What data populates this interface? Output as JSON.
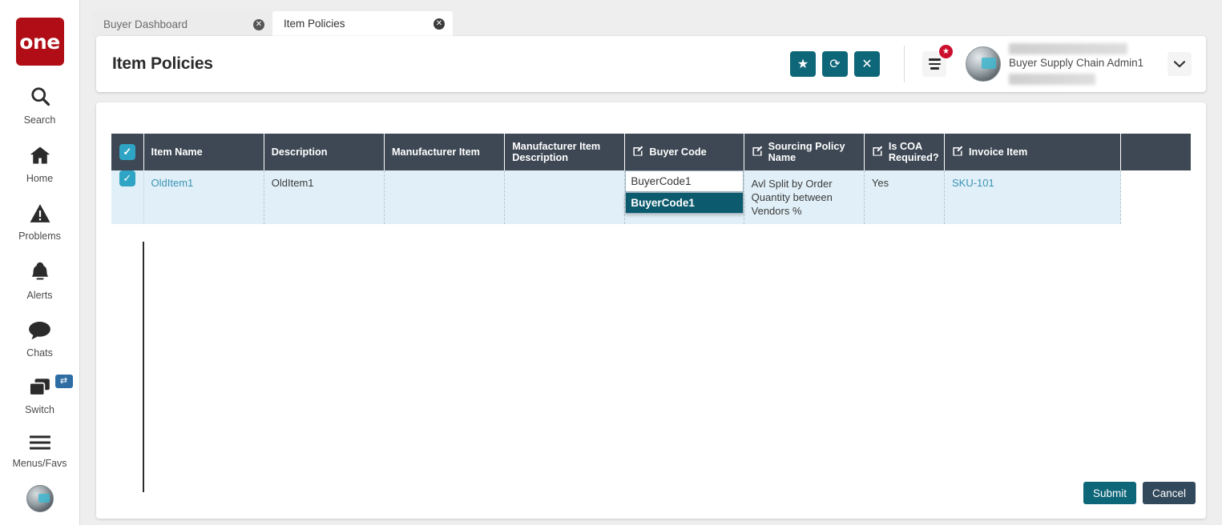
{
  "brand": {
    "logo_text": "one",
    "logo_color": "#b00d16"
  },
  "leftnav": {
    "items": [
      {
        "label": "Search",
        "icon": "search-icon"
      },
      {
        "label": "Home",
        "icon": "home-icon"
      },
      {
        "label": "Problems",
        "icon": "warning-triangle-icon"
      },
      {
        "label": "Alerts",
        "icon": "bell-icon"
      },
      {
        "label": "Chats",
        "icon": "chat-bubble-icon"
      },
      {
        "label": "Switch",
        "icon": "switch-windows-icon",
        "badge_icon": "swap-arrows-icon"
      },
      {
        "label": "Menus/Favs",
        "icon": "hamburger-icon"
      }
    ],
    "avatar": "user-avatar"
  },
  "tabs": [
    {
      "label": "Buyer Dashboard",
      "active": false,
      "close": "✕"
    },
    {
      "label": "Item Policies",
      "active": true,
      "close": "✕"
    }
  ],
  "header": {
    "title": "Item Policies",
    "actions": [
      {
        "name": "favorite-button",
        "icon": "star-icon",
        "glyph": "★"
      },
      {
        "name": "refresh-button",
        "icon": "refresh-icon",
        "glyph": "⟳"
      },
      {
        "name": "close-button",
        "icon": "close-icon",
        "glyph": "✕"
      }
    ],
    "menu_badge_glyph": "★",
    "user_name": "Buyer Supply Chain Admin1",
    "caret_glyph": "⌄",
    "accent_color": "#0e6679"
  },
  "table": {
    "columns": [
      {
        "label": "",
        "type": "checkbox"
      },
      {
        "label": "Item Name",
        "editable": false
      },
      {
        "label": "Description",
        "editable": false
      },
      {
        "label": "Manufacturer Item",
        "editable": false
      },
      {
        "label": "Manufacturer Item Description",
        "editable": false
      },
      {
        "label": "Buyer Code",
        "editable": true
      },
      {
        "label": "Sourcing Policy Name",
        "editable": true
      },
      {
        "label": "Is COA Required?",
        "editable": true
      },
      {
        "label": "Invoice Item",
        "editable": true
      },
      {
        "label": "",
        "editable": false
      }
    ],
    "rows": [
      {
        "selected": true,
        "item_name": "OldItem1",
        "description": "OldItem1",
        "manufacturer_item": "",
        "manufacturer_item_description": "",
        "buyer_code": "BuyerCode1",
        "sourcing_policy_name": "Avl Split by Order Quantity between Vendors %",
        "is_coa_required": "Yes",
        "invoice_item": "SKU-101"
      }
    ],
    "header_bg": "#3e4854",
    "row_bg": "#e1f0f8",
    "checkbox_color": "#2fa4c4",
    "edit_icon_glyph": "✎"
  },
  "autocomplete": {
    "input_value": "BuyerCode1",
    "options": [
      {
        "label": "BuyerCode1",
        "selected": true
      }
    ],
    "selected_bg": "#0c5a6d"
  },
  "footer": {
    "submit_label": "Submit",
    "cancel_label": "Cancel",
    "submit_color": "#0e6679",
    "cancel_color": "#32495c"
  }
}
